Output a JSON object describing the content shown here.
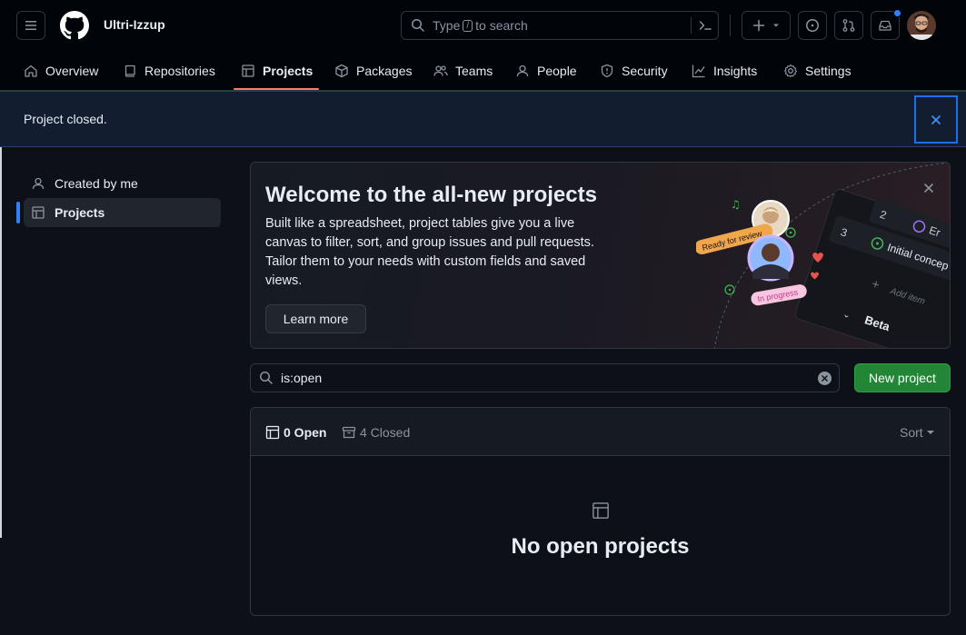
{
  "header": {
    "org_name": "Ultri-Izzup",
    "search": {
      "prefix": "Type",
      "slash": "/",
      "suffix": "to search"
    }
  },
  "nav": {
    "items": [
      {
        "label": "Overview",
        "icon": "home-icon"
      },
      {
        "label": "Repositories",
        "icon": "repo-icon"
      },
      {
        "label": "Projects",
        "icon": "table-icon",
        "active": true
      },
      {
        "label": "Packages",
        "icon": "package-icon"
      },
      {
        "label": "Teams",
        "icon": "people-icon"
      },
      {
        "label": "People",
        "icon": "person-icon"
      },
      {
        "label": "Security",
        "icon": "shield-icon"
      },
      {
        "label": "Insights",
        "icon": "graph-icon"
      },
      {
        "label": "Settings",
        "icon": "gear-icon"
      }
    ]
  },
  "flash": {
    "message": "Project closed."
  },
  "sidebar": {
    "items": [
      {
        "label": "Created by me",
        "icon": "person-icon"
      },
      {
        "label": "Projects",
        "icon": "table-icon",
        "selected": true
      }
    ]
  },
  "banner": {
    "title": "Welcome to the all-new projects",
    "description": "Built like a spreadsheet, project tables give you a live canvas to filter, sort, and group issues and pull requests. Tailor them to your needs with custom fields and saved views.",
    "learn_more": "Learn more",
    "illustration": {
      "row2_num": "2",
      "row3_num": "3",
      "row3_text": "Initial concep",
      "add_item": "Add item",
      "beta": "Beta",
      "badge_review": "Ready for review",
      "badge_progress": "In progress"
    }
  },
  "filter": {
    "value": "is:open"
  },
  "new_project": "New project",
  "projects": {
    "open_tab": "0 Open",
    "closed_tab": "4 Closed",
    "sort_label": "Sort",
    "empty_title": "No open projects"
  },
  "colors": {
    "accent": "#2f81f7",
    "primary_button": "#238636",
    "nav_underline": "#f78166",
    "notification_dot": "#2f81f7"
  }
}
